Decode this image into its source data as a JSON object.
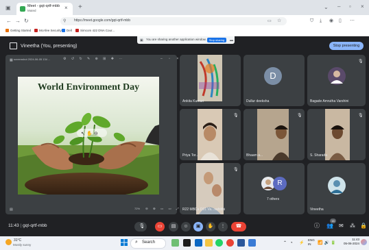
{
  "browser": {
    "tab": {
      "title": "Meet - gqt-qrtf-mbb",
      "subtitle": "Muted"
    },
    "url": "https://meet.google.com/gqt-qrtf-mbb",
    "bookmarks": [
      "Getting Started",
      "McAfee Security",
      "Dell",
      "Simcom 422 DNA Cour..."
    ]
  },
  "meet": {
    "share_banner": {
      "text": "You are sharing another application window.",
      "stop_label": "Stop sharing"
    },
    "presenter_label": "Vineetha (You, presenting)",
    "stop_presenting_label": "Stop presenting",
    "shared_file": "screenshot 2024-06-05 134 ...",
    "slide_title": "World Environment Day",
    "slide_zoom": "72%",
    "participants": [
      {
        "name": "Ankita Kumari"
      },
      {
        "name": "Dullur deeksha",
        "initial": "D",
        "avatar_color": "#7b8ea6"
      },
      {
        "name": "Bagade Amrutha Varshini"
      },
      {
        "name": "Priya Tor..."
      },
      {
        "name": "Bhaam a..."
      },
      {
        "name": "S. Sharada"
      },
      {
        "name": "R22 MBCa D01 Va...sahitthi"
      },
      {
        "name": "7 others",
        "initial": "R",
        "avatar_color": "#5c6bc0"
      },
      {
        "name": "Vineetha"
      }
    ],
    "meeting_time": "11:43",
    "meeting_code": "gqt-qrtf-mbb",
    "people_count": "16"
  },
  "taskbar": {
    "weather_temp": "31°C",
    "weather_desc": "Mostly sunny",
    "search_placeholder": "Search",
    "language": "ENG",
    "language_region": "IN",
    "time": "11:43",
    "date": "05-06-2024"
  },
  "colors": {
    "meet_bg": "#202124",
    "tile_bg": "#3c4043",
    "accent_blue": "#8ab4f8",
    "end_call_red": "#ea4335"
  }
}
